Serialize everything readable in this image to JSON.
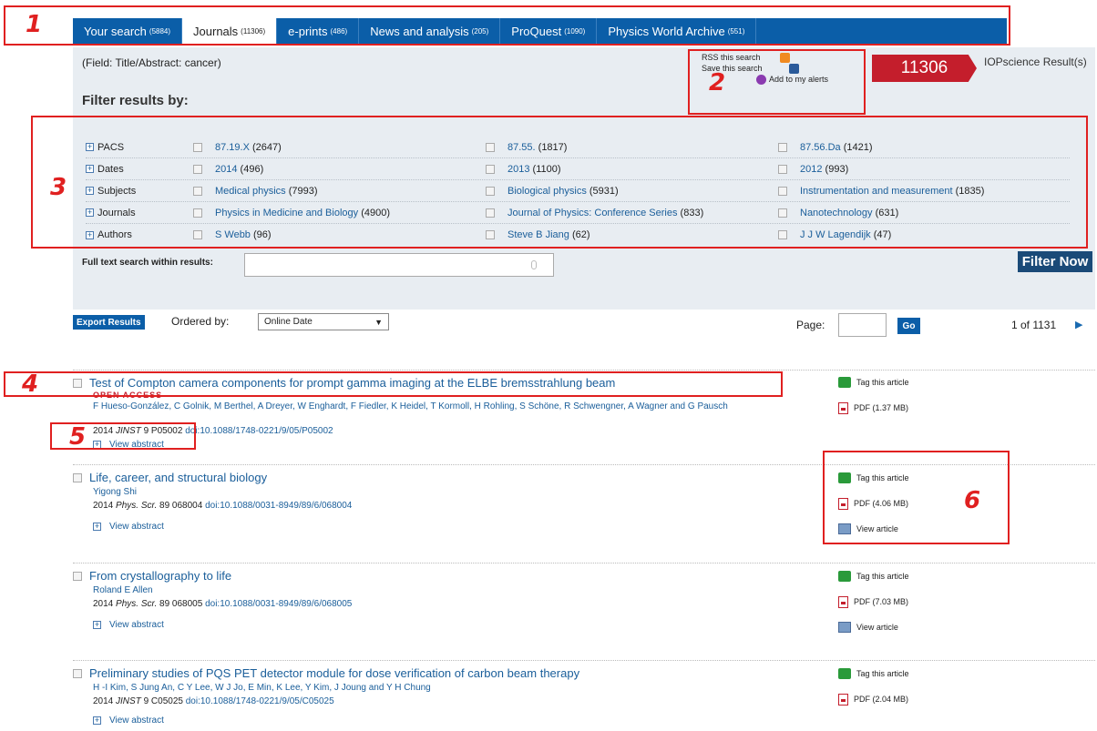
{
  "tabs": [
    {
      "label": "Your search",
      "count": "(5884)"
    },
    {
      "label": "Journals",
      "count": "(11306)"
    },
    {
      "label": "e-prints",
      "count": "(486)"
    },
    {
      "label": "News and analysis",
      "count": "(205)"
    },
    {
      "label": "ProQuest",
      "count": "(1090)"
    },
    {
      "label": "Physics World Archive",
      "count": "(551)"
    }
  ],
  "search": {
    "field_text": "(Field: Title/Abstract: cancer)",
    "filter_title": "Filter results by:",
    "fulltext_label": "Full text search within results:",
    "filter_button": "Filter Now"
  },
  "tools": {
    "rss": "RSS this search",
    "save": "Save this search",
    "alerts": "Add to my alerts"
  },
  "result_count": {
    "value": "11306",
    "label": "IOPscience Result(s)"
  },
  "filters": [
    {
      "category": "PACS",
      "options": [
        {
          "label": "87.19.X",
          "count": "(2647)"
        },
        {
          "label": "87.55.",
          "count": "(1817)"
        },
        {
          "label": "87.56.Da",
          "count": "(1421)"
        }
      ]
    },
    {
      "category": "Dates",
      "options": [
        {
          "label": "2014",
          "count": "(496)"
        },
        {
          "label": "2013",
          "count": "(1100)"
        },
        {
          "label": "2012",
          "count": "(993)"
        }
      ]
    },
    {
      "category": "Subjects",
      "options": [
        {
          "label": "Medical physics",
          "count": "(7993)"
        },
        {
          "label": "Biological physics",
          "count": "(5931)"
        },
        {
          "label": "Instrumentation and measurement",
          "count": "(1835)"
        }
      ]
    },
    {
      "category": "Journals",
      "options": [
        {
          "label": "Physics in Medicine and Biology",
          "count": "(4900)"
        },
        {
          "label": "Journal of Physics: Conference Series",
          "count": "(833)"
        },
        {
          "label": "Nanotechnology",
          "count": "(631)"
        }
      ]
    },
    {
      "category": "Authors",
      "options": [
        {
          "label": "S Webb",
          "count": "(96)"
        },
        {
          "label": "Steve B Jiang",
          "count": "(62)"
        },
        {
          "label": "J J W Lagendijk",
          "count": "(47)"
        }
      ]
    }
  ],
  "controls": {
    "export": "Export Results",
    "ordered_by": "Ordered by:",
    "order_value": "Online Date",
    "page_label": "Page:",
    "go": "Go",
    "page_info": "1 of 1131"
  },
  "results": [
    {
      "title": "Test of Compton camera components for prompt gamma imaging at the ELBE bremsstrahlung beam",
      "open_access": "OPEN ACCESS",
      "authors": "F Hueso-González, C Golnik, M Berthel, A Dreyer, W Enghardt, F Fiedler, K Heidel, T Kormoll, H Rohling, S Schöne, R Schwengner, A Wagner and G Pausch",
      "cite_prefix": "2014",
      "journal": "JINST",
      "cite_rest": "9 P05002",
      "doi": "doi:10.1088/1748-0221/9/05/P05002",
      "view_abstract": "View abstract",
      "tag": "Tag this article",
      "pdf": "PDF (1.37 MB)"
    },
    {
      "title": "Life, career, and structural biology",
      "authors": "Yigong Shi",
      "cite_prefix": "2014",
      "journal": "Phys. Scr.",
      "cite_rest": "89 068004",
      "doi": "doi:10.1088/0031-8949/89/6/068004",
      "view_abstract": "View abstract",
      "tag": "Tag this article",
      "pdf": "PDF (4.06 MB)",
      "view_article": "View article"
    },
    {
      "title": "From crystallography to life",
      "authors": "Roland E Allen",
      "cite_prefix": "2014",
      "journal": "Phys. Scr.",
      "cite_rest": "89 068005",
      "doi": "doi:10.1088/0031-8949/89/6/068005",
      "view_abstract": "View abstract",
      "tag": "Tag this article",
      "pdf": "PDF (7.03 MB)",
      "view_article": "View article"
    },
    {
      "title": "Preliminary studies of PQS PET detector module for dose verification of carbon beam therapy",
      "authors": "H -I Kim, S Jung An, C Y Lee, W J Jo, E Min, K Lee, Y Kim, J Joung and Y H Chung",
      "cite_prefix": "2014",
      "journal": "JINST",
      "cite_rest": "9 C05025",
      "doi": "doi:10.1088/1748-0221/9/05/C05025",
      "view_abstract": "View abstract",
      "tag": "Tag this article",
      "pdf": "PDF (2.04 MB)"
    }
  ],
  "annotations": [
    "1",
    "2",
    "3",
    "4",
    "5",
    "6"
  ],
  "colors": {
    "tab_bar": "#0b5ea8",
    "count_badge": "#c41e2c",
    "link": "#1a5e9a",
    "annotation": "#e02020"
  }
}
